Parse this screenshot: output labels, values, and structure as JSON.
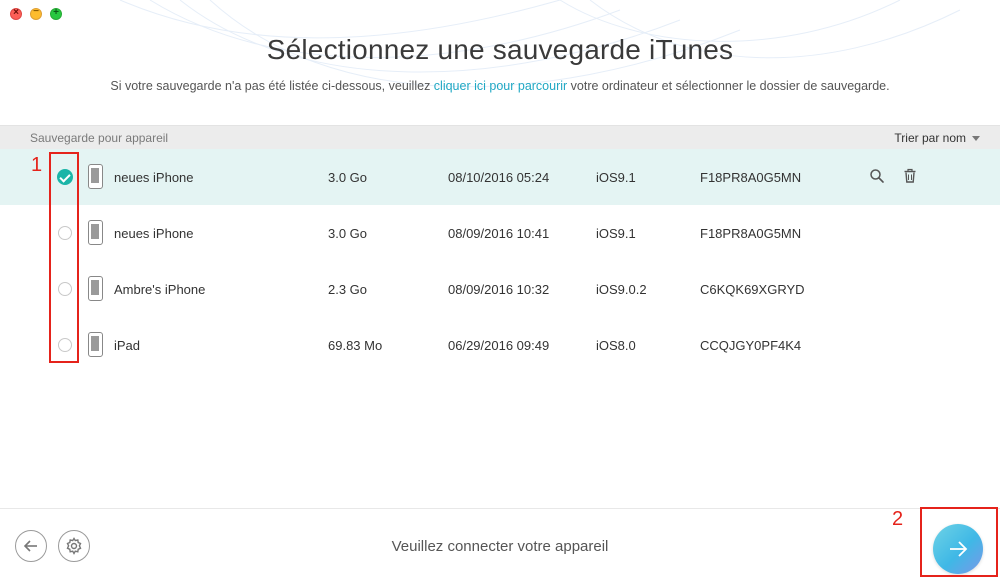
{
  "window": {
    "controls": [
      {
        "name": "close",
        "glyph": "×",
        "color": "#fc5f57"
      },
      {
        "name": "minimize",
        "glyph": "−",
        "color": "#fdbc2e"
      },
      {
        "name": "zoom",
        "glyph": "+",
        "color": "#28c840"
      }
    ]
  },
  "header": {
    "title": "Sélectionnez une sauvegarde iTunes",
    "subtitle_before": "Si votre sauvegarde n'a pas été listée ci-dessous, veuillez ",
    "subtitle_link": "cliquer ici pour parcourir",
    "subtitle_after": " votre ordinateur et sélectionner le dossier de sauvegarde."
  },
  "list": {
    "header_label": "Sauvegarde pour appareil",
    "sort_label": "Trier par nom",
    "rows": [
      {
        "name": "neues iPhone",
        "size": "3.0 Go",
        "date": "08/10/2016 05:24",
        "ios": "iOS9.1",
        "id": "F18PR8A0G5MN",
        "selected": true
      },
      {
        "name": "neues iPhone",
        "size": "3.0 Go",
        "date": "08/09/2016 10:41",
        "ios": "iOS9.1",
        "id": "F18PR8A0G5MN",
        "selected": false
      },
      {
        "name": "Ambre's iPhone",
        "size": "2.3 Go",
        "date": "08/09/2016 10:32",
        "ios": "iOS9.0.2",
        "id": "C6KQK69XGRYD",
        "selected": false
      },
      {
        "name": "iPad",
        "size": "69.83 Mo",
        "date": "06/29/2016 09:49",
        "ios": "iOS8.0",
        "id": "CCQJGY0PF4K4",
        "selected": false
      }
    ]
  },
  "annotations": {
    "step1": "1",
    "step2": "2"
  },
  "footer": {
    "status": "Veuillez connecter votre appareil"
  },
  "colors": {
    "accent": "#1bb5a8",
    "link": "#20a8c4",
    "selected_row": "#e4f4f3",
    "annotation": "#e5231b"
  },
  "icons": [
    "search-icon",
    "trash-icon",
    "back-arrow-icon",
    "gear-icon",
    "next-arrow-icon",
    "phone-icon"
  ]
}
